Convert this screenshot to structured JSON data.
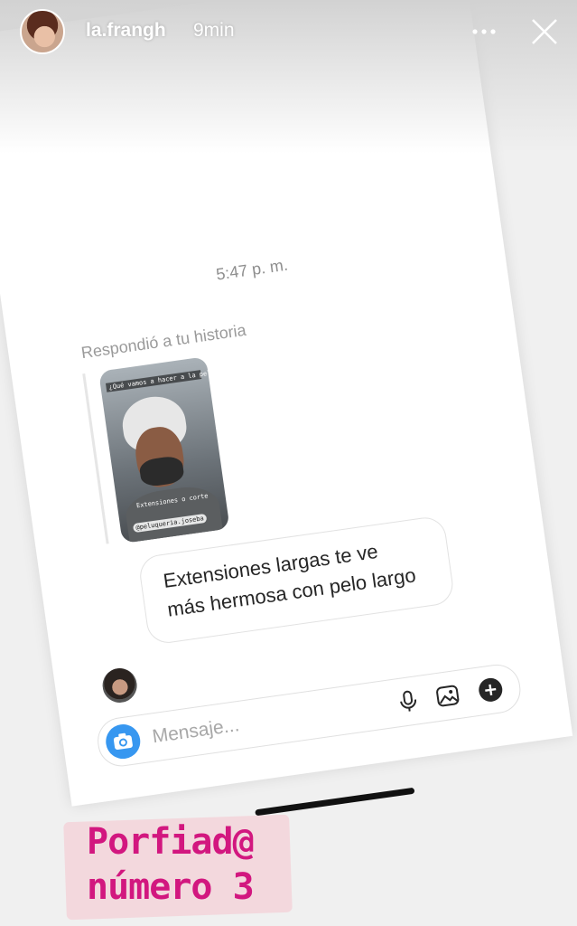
{
  "story_header": {
    "username": "la.frangh",
    "time_ago": "9min"
  },
  "dm_screenshot": {
    "timestamp": "5:47 p. m.",
    "replied_label": "Respondió a tu historia",
    "story_thumbnail": {
      "top_text": "¿Qué vamos a hacer a la peluquería?",
      "middle_text": "Extensiones o corte",
      "handle": "@peluqueria.joseba"
    },
    "message": {
      "line1": "Extensiones largas te ve",
      "line2": "más hermosa con pelo largo"
    },
    "composer": {
      "placeholder": "Mensaje..."
    },
    "icons": {
      "camera": "camera-icon",
      "mic": "microphone-icon",
      "gallery": "gallery-icon",
      "plus": "plus-icon"
    }
  },
  "caption": {
    "line1": "Porfiad@",
    "line2": "número 3"
  },
  "colors": {
    "accent_blue": "#3797f0",
    "caption_pink": "#d2177f"
  }
}
